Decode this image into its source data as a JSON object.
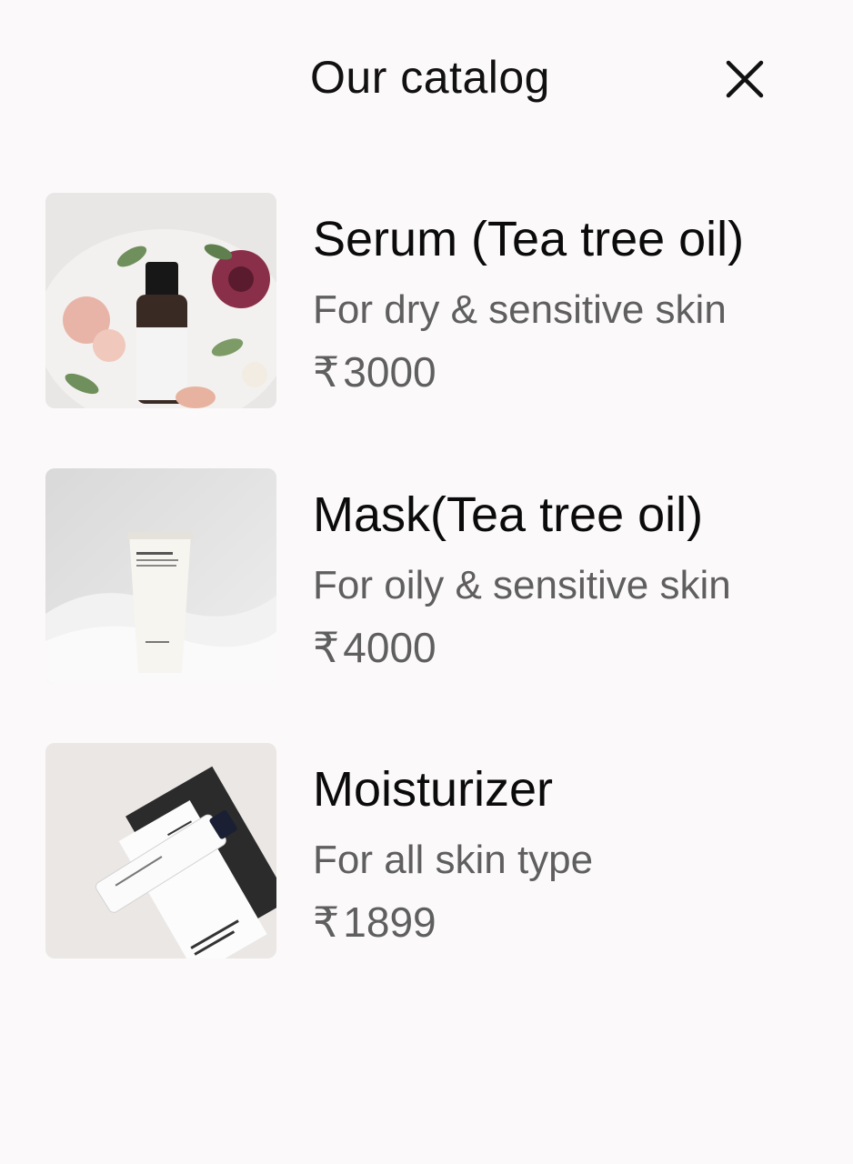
{
  "header": {
    "title": "Our catalog"
  },
  "products": [
    {
      "name": "Serum (Tea tree oil)",
      "description": "For dry & sensitive skin",
      "currency": "₹",
      "price": "3000"
    },
    {
      "name": "Mask(Tea tree oil)",
      "description": "For oily & sensitive skin",
      "currency": "₹",
      "price": "4000"
    },
    {
      "name": "Moisturizer",
      "description": "For all skin type",
      "currency": "₹",
      "price": "1899"
    }
  ],
  "icons": {
    "close": "close-icon"
  },
  "colors": {
    "background": "#fbf9fa",
    "title_text": "#0b0b0b",
    "secondary_text": "#5f5f5f"
  }
}
